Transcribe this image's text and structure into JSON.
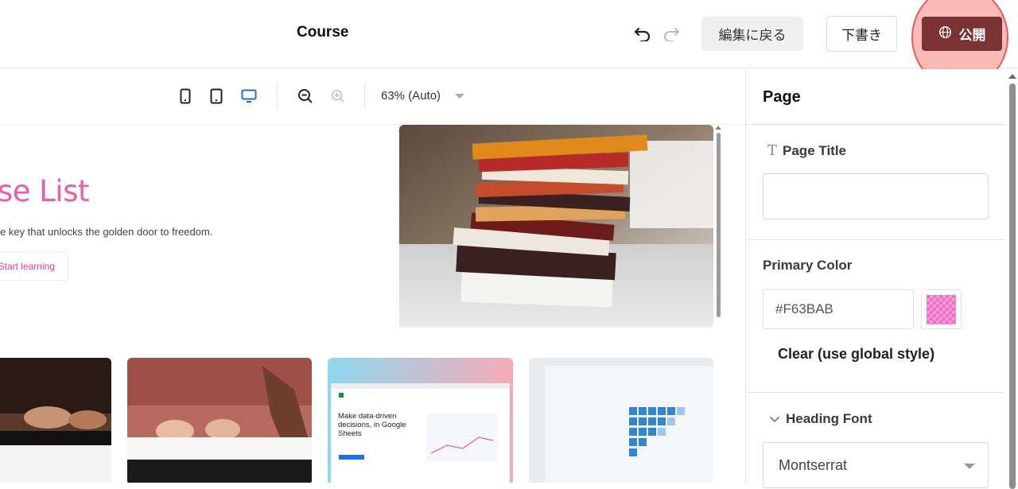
{
  "header": {
    "title": "Course",
    "back_label": "編集に戻る",
    "draft_label": "下書き",
    "publish_label": "公開"
  },
  "toolbar": {
    "devices": [
      "mobile-icon",
      "tablet-icon",
      "desktop-icon"
    ],
    "active_device": "desktop",
    "zoom_label": "63% (Auto)"
  },
  "preview": {
    "hero_title": "se List",
    "hero_subtitle": "e key that unlocks the golden door to freedom.",
    "hero_button": "Start learning",
    "cards": [
      {
        "image": "piano-hands"
      },
      {
        "image": "piano-child"
      },
      {
        "image": "google-sheets",
        "heading": "Make data-driven decisions, in Google Sheets"
      },
      {
        "image": "spreadsheet-screen"
      }
    ]
  },
  "panel": {
    "title": "Page",
    "page_title_label": "Page Title",
    "page_title_value": "",
    "primary_color_label": "Primary Color",
    "primary_color_value": "#F63BAB",
    "clear_label": "Clear (use global style)",
    "heading_font_label": "Heading Font",
    "heading_font_value": "Montserrat"
  },
  "colors": {
    "accent": "#F63BAB",
    "publish_button": "#7A3232",
    "highlight": "#EE5B55"
  }
}
